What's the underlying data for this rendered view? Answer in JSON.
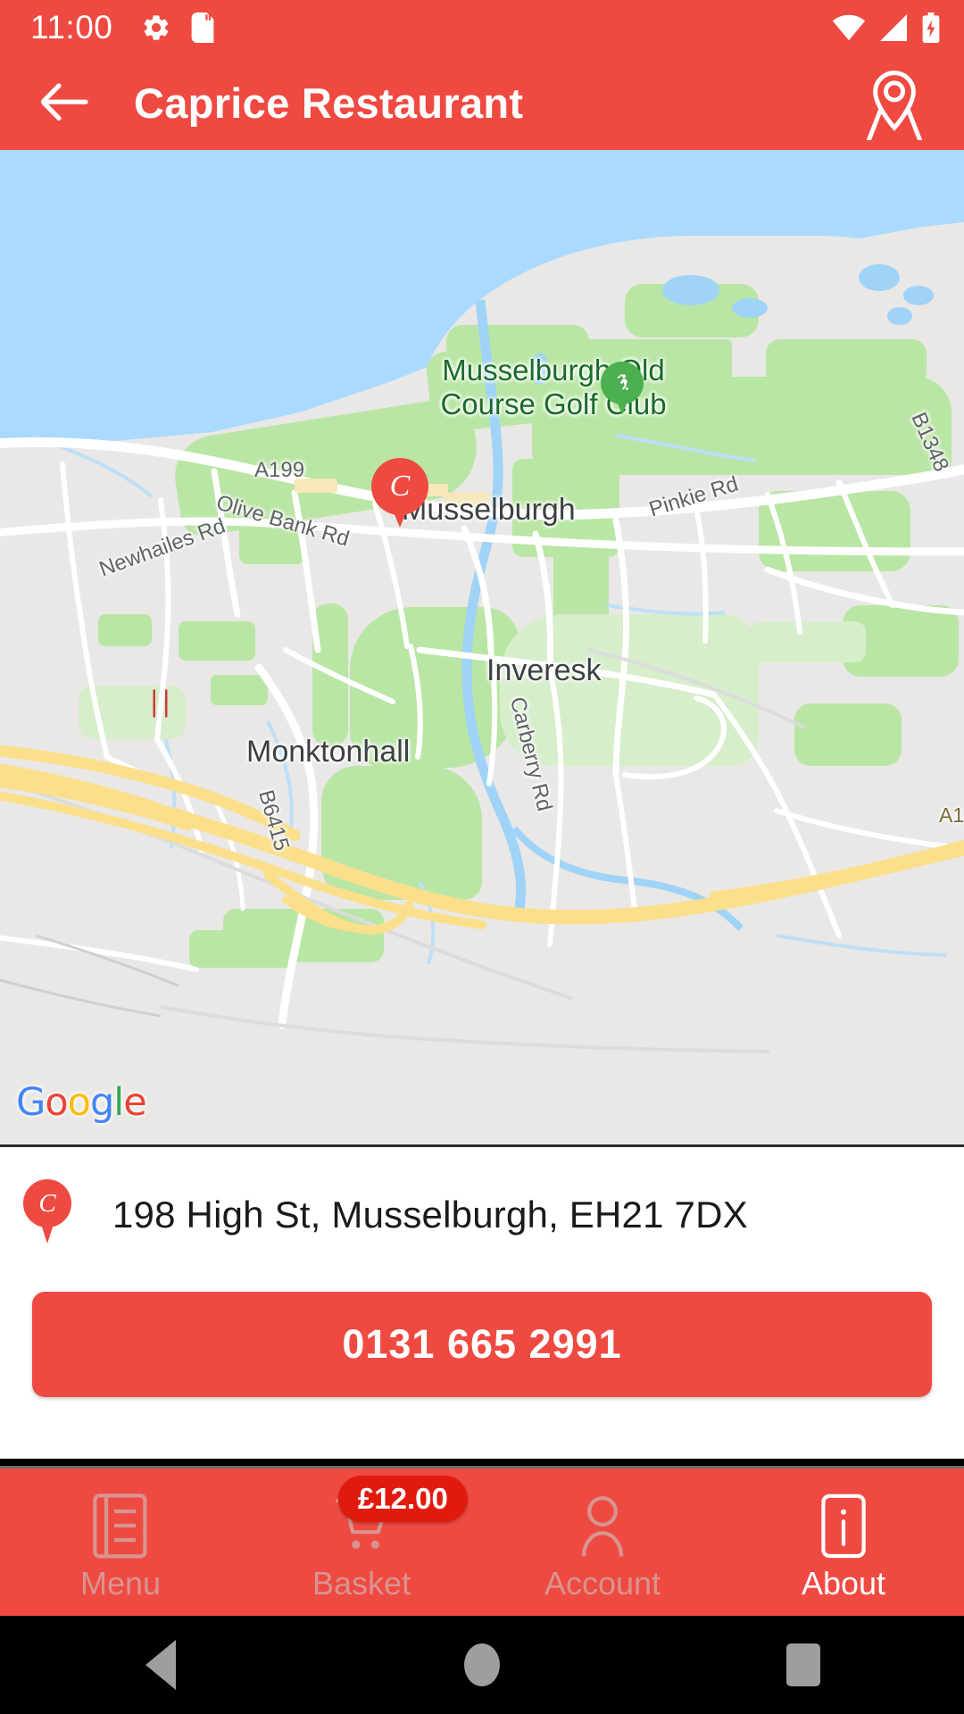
{
  "status_bar": {
    "time": "11:00",
    "icons": [
      "gear-icon",
      "sd-card-icon",
      "wifi-icon",
      "cellular-signal-icon",
      "battery-charging-icon"
    ]
  },
  "header": {
    "title": "Caprice Restaurant",
    "back_icon": "arrow-left-icon",
    "action_icon": "map-pin-icon"
  },
  "map": {
    "attribution": "Google",
    "attribution_letters": [
      "G",
      "o",
      "o",
      "g",
      "l",
      "e"
    ],
    "marker_label": "C",
    "poi_labels": [
      {
        "text": "Musselburgh Old\nCourse Golf Club",
        "type": "poi"
      },
      {
        "text": "Musselburgh",
        "type": "place"
      },
      {
        "text": "Inveresk",
        "type": "place"
      },
      {
        "text": "Monktonhall",
        "type": "place"
      }
    ],
    "road_labels": [
      {
        "text": "A199"
      },
      {
        "text": "Newhailes Rd"
      },
      {
        "text": "Olive Bank Rd"
      },
      {
        "text": "Pinkie Rd"
      },
      {
        "text": "Carberry Rd"
      },
      {
        "text": "B6415"
      },
      {
        "text": "B1348"
      },
      {
        "text": "A1"
      }
    ],
    "golf_pin_icon": "golf-marker-icon",
    "rail_icon": "train-station-icon"
  },
  "info": {
    "address": "198 High St, Musselburgh, EH21 7DX",
    "address_pin_label": "C",
    "phone": "0131 665 2991"
  },
  "bottom_nav": {
    "items": [
      {
        "label": "Menu",
        "icon": "menu-list-icon",
        "active": false,
        "badge": ""
      },
      {
        "label": "Basket",
        "icon": "shopping-cart-icon",
        "active": false,
        "badge": "£12.00"
      },
      {
        "label": "Account",
        "icon": "person-icon",
        "active": false,
        "badge": ""
      },
      {
        "label": "About",
        "icon": "info-icon",
        "active": true,
        "badge": ""
      }
    ]
  },
  "android_nav": {
    "back": "back-triangle-icon",
    "home": "home-circle-icon",
    "recents": "recents-square-icon"
  },
  "colors": {
    "brand": "#ef4a42",
    "badge": "#e01b0e",
    "map_water": "#aadaff",
    "map_land": "#e9e8e6",
    "map_green": "#b9e6a4",
    "poi_text": "#1a6b2a"
  }
}
